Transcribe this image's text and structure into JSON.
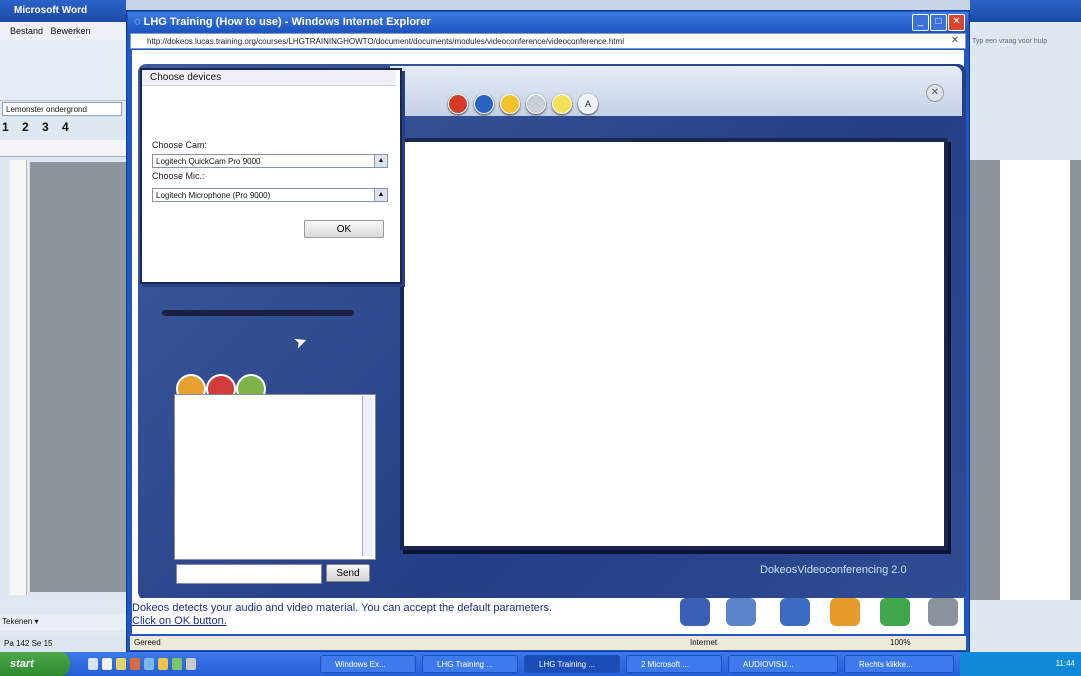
{
  "background": {
    "left_title": "Microsoft Word",
    "left_menu": [
      "Bestand",
      "Bewerken"
    ],
    "left_style_box": "Lemonster ondergrond",
    "left_numbers": "1 2 3 4",
    "left_bottom": "Tekenen ▾",
    "left_status": "Pa 142   Se 15",
    "right_search": "Typ een vraag voor hulp"
  },
  "ie": {
    "title": "LHG Training (How to use) - Windows Internet Explorer",
    "address": "http://dokeos.lucas.training.org/courses/LHGTRAININGHOWTO/document/documents/modules/videoconference/videoconference.html",
    "status_left": "Gereed",
    "status_zone": "Internet",
    "zoom": "100%"
  },
  "dialog": {
    "title": "Choose devices",
    "cam_label": "Choose Cam:",
    "cam_value": "Logitech QuickCam Pro 9000",
    "mic_label": "Choose Mic.:",
    "mic_value": "Logitech Microphone (Pro 9000)",
    "ok_label": "OK"
  },
  "app": {
    "brand": "DokeosVideoconferencing 2.0",
    "send_label": "Send",
    "hint_line1": "Dokeos detects your audio and video material. You can accept the default parameters.",
    "hint_line2": "Click on OK button.",
    "toolbar_icons": [
      "record-icon",
      "camera-icon",
      "pencil-icon",
      "glasses-icon",
      "line-icon",
      "text-icon"
    ],
    "colors": {
      "app_blue": "#243f86",
      "ie_blue": "#1f58c6"
    }
  },
  "taskbar": {
    "start": "start",
    "tasks": [
      "Windows Ex...",
      "LHG Training ...",
      "LHG Training ...",
      "2 Microsoft ...",
      "AUDIOVISU...",
      "Rechts klikke..."
    ],
    "clock": "11:44"
  }
}
